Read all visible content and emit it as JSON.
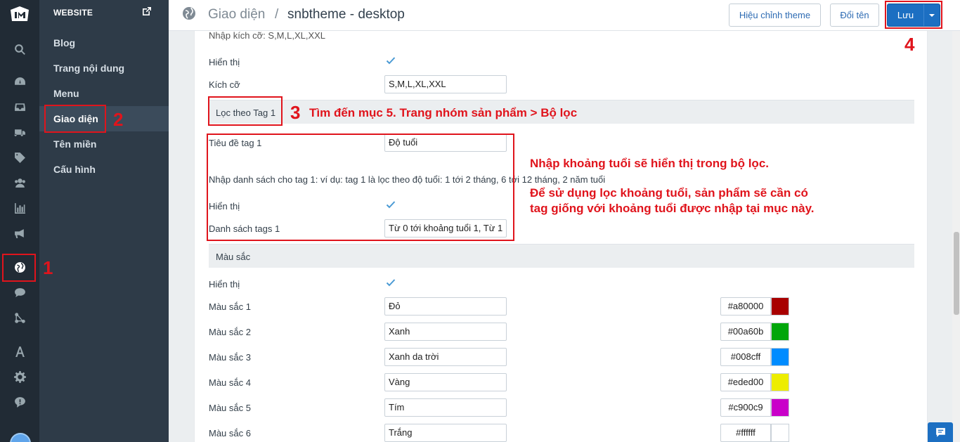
{
  "rail": {
    "icons": [
      "logo-icon",
      "search-icon",
      "dashboard-icon",
      "inbox-icon",
      "truck-icon",
      "tag-icon",
      "customers-icon",
      "chart-icon",
      "megaphone-icon",
      "website-icon",
      "chat-icon",
      "apps-icon",
      "font-icon",
      "settings-icon",
      "help-icon"
    ],
    "active": "website-icon"
  },
  "menu": {
    "header": "WEBSITE",
    "items": [
      {
        "label": "Blog"
      },
      {
        "label": "Trang nội dung"
      },
      {
        "label": "Menu"
      },
      {
        "label": "Giao diện",
        "active": true
      },
      {
        "label": "Tên miền"
      },
      {
        "label": "Cấu hình"
      }
    ]
  },
  "topbar": {
    "crumb_parent": "Giao diện",
    "crumb_sep": "/",
    "crumb_current": "snbtheme - desktop",
    "edit_theme_label": "Hiệu chỉnh theme",
    "rename_label": "Đổi tên",
    "save_label": "Lưu"
  },
  "form": {
    "size_note": "Nhập kích cỡ: S,M,L,XL,XXL",
    "size_show_label": "Hiển thị",
    "size_label": "Kích cỡ",
    "size_value": "S,M,L,XL,XXL",
    "tag_section": "Lọc theo Tag 1",
    "tag_title_label": "Tiêu đề tag 1",
    "tag_title_value": "Độ tuổi",
    "tag_note": "Nhập danh sách cho tag 1: ví dụ: tag 1 là lọc theo độ tuổi: 1 tới 2 tháng, 6 tới 12 tháng, 2 năm tuổi",
    "tag_show_label": "Hiển thị",
    "tag_list_label": "Danh sách tags 1",
    "tag_list_value": "Từ 0 tới khoảng tuổi 1, Từ 1",
    "color_section": "Màu sắc",
    "color_show_label": "Hiển thị",
    "colors": [
      {
        "label": "Màu sắc 1",
        "name": "Đỏ",
        "hex": "#a80000"
      },
      {
        "label": "Màu sắc 2",
        "name": "Xanh",
        "hex": "#00a60b"
      },
      {
        "label": "Màu sắc 3",
        "name": "Xanh da trời",
        "hex": "#008cff"
      },
      {
        "label": "Màu sắc 4",
        "name": "Vàng",
        "hex": "#eded00"
      },
      {
        "label": "Màu sắc 5",
        "name": "Tím",
        "hex": "#c900c9"
      },
      {
        "label": "Màu sắc 6",
        "name": "Trắng",
        "hex": "#ffffff"
      }
    ]
  },
  "annotations": {
    "n1": "1",
    "n2": "2",
    "n3": "3",
    "n4": "4",
    "step3": "Tìm đến mục 5. Trang nhóm sản phẩm > Bộ lọc",
    "note_a": "Nhập khoảng tuổi sẽ hiển thị trong bộ lọc.",
    "note_b": "Để sử dụng lọc khoảng tuổi, sản phẩm sẽ cần có tag giống với khoảng tuổi được nhập tại mục này."
  },
  "colors": {
    "rail_bg": "#212b35",
    "menu_bg": "#2e3b48",
    "primary": "#1c6fc2",
    "annotation": "#e0141c"
  }
}
